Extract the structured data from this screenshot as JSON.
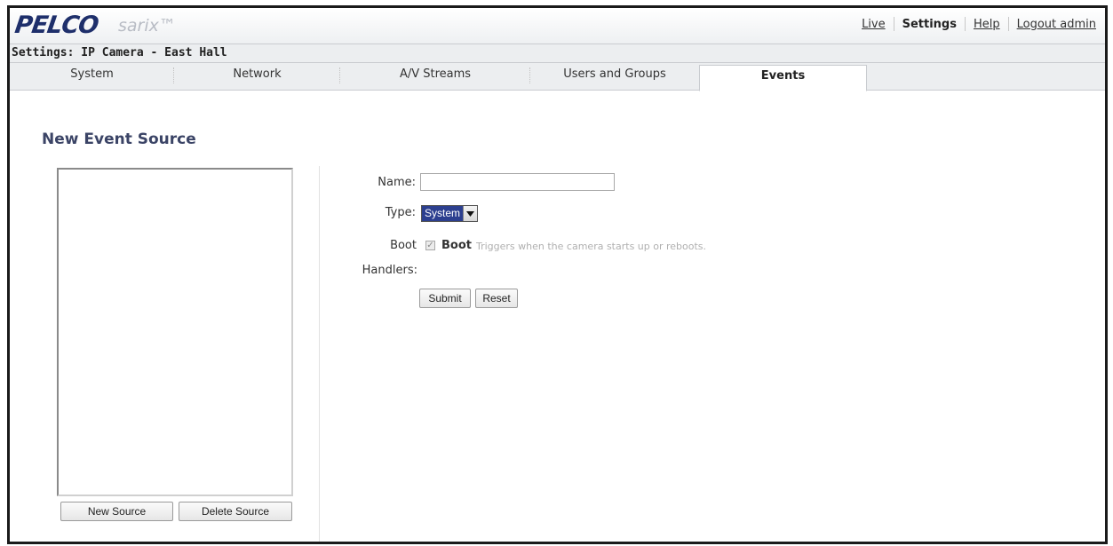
{
  "header": {
    "logo": "PELCO",
    "logo_sub": "sarix™",
    "links": {
      "live": "Live",
      "settings": "Settings",
      "help": "Help",
      "logout": "Logout admin"
    }
  },
  "breadcrumb": "Settings: IP Camera - East Hall",
  "tabs": [
    {
      "label": "System"
    },
    {
      "label": "Network"
    },
    {
      "label": "A/V Streams"
    },
    {
      "label": "Users and Groups"
    },
    {
      "label": "Events",
      "active": true
    }
  ],
  "page": {
    "title": "New Event Source",
    "buttons": {
      "new_source": "New Source",
      "delete_source": "Delete Source"
    }
  },
  "form": {
    "name_label": "Name:",
    "name_value": "",
    "type_label": "Type:",
    "type_value": "System",
    "boot_label": "Boot",
    "boot_checked": true,
    "boot_inline_label": "Boot",
    "boot_description": "Triggers when the camera starts up or reboots.",
    "handlers_label": "Handlers:",
    "submit": "Submit",
    "reset": "Reset"
  },
  "colors": {
    "title": "#3b4466",
    "logo": "#1e2f6b",
    "select_highlight": "#2c3f8f"
  }
}
